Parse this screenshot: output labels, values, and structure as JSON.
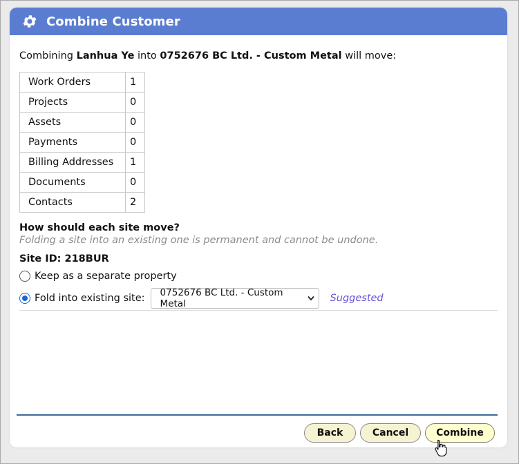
{
  "dialog": {
    "title": "Combine Customer",
    "icon": "gear-icon",
    "header_color": "#5a7dd1"
  },
  "intro": {
    "prefix": "Combining",
    "source": "Lanhua Ye",
    "middle": "into",
    "target": "0752676 BC Ltd. - Custom Metal",
    "suffix": "will move:"
  },
  "moves": [
    {
      "label": "Work Orders",
      "count": "1"
    },
    {
      "label": "Projects",
      "count": "0"
    },
    {
      "label": "Assets",
      "count": "0"
    },
    {
      "label": "Payments",
      "count": "0"
    },
    {
      "label": "Billing Addresses",
      "count": "1"
    },
    {
      "label": "Documents",
      "count": "0"
    },
    {
      "label": "Contacts",
      "count": "2"
    }
  ],
  "sites": {
    "question": "How should each site move?",
    "warning": "Folding a site into an existing one is permanent and cannot be undone.",
    "site_id": "Site ID: 218BUR",
    "option_keep": "Keep as a separate property",
    "option_fold": "Fold into existing site:",
    "selected_option": "fold",
    "fold_target": "0752676 BC Ltd. - Custom Metal",
    "suggested": "Suggested"
  },
  "buttons": {
    "back": "Back",
    "cancel": "Cancel",
    "combine": "Combine"
  }
}
